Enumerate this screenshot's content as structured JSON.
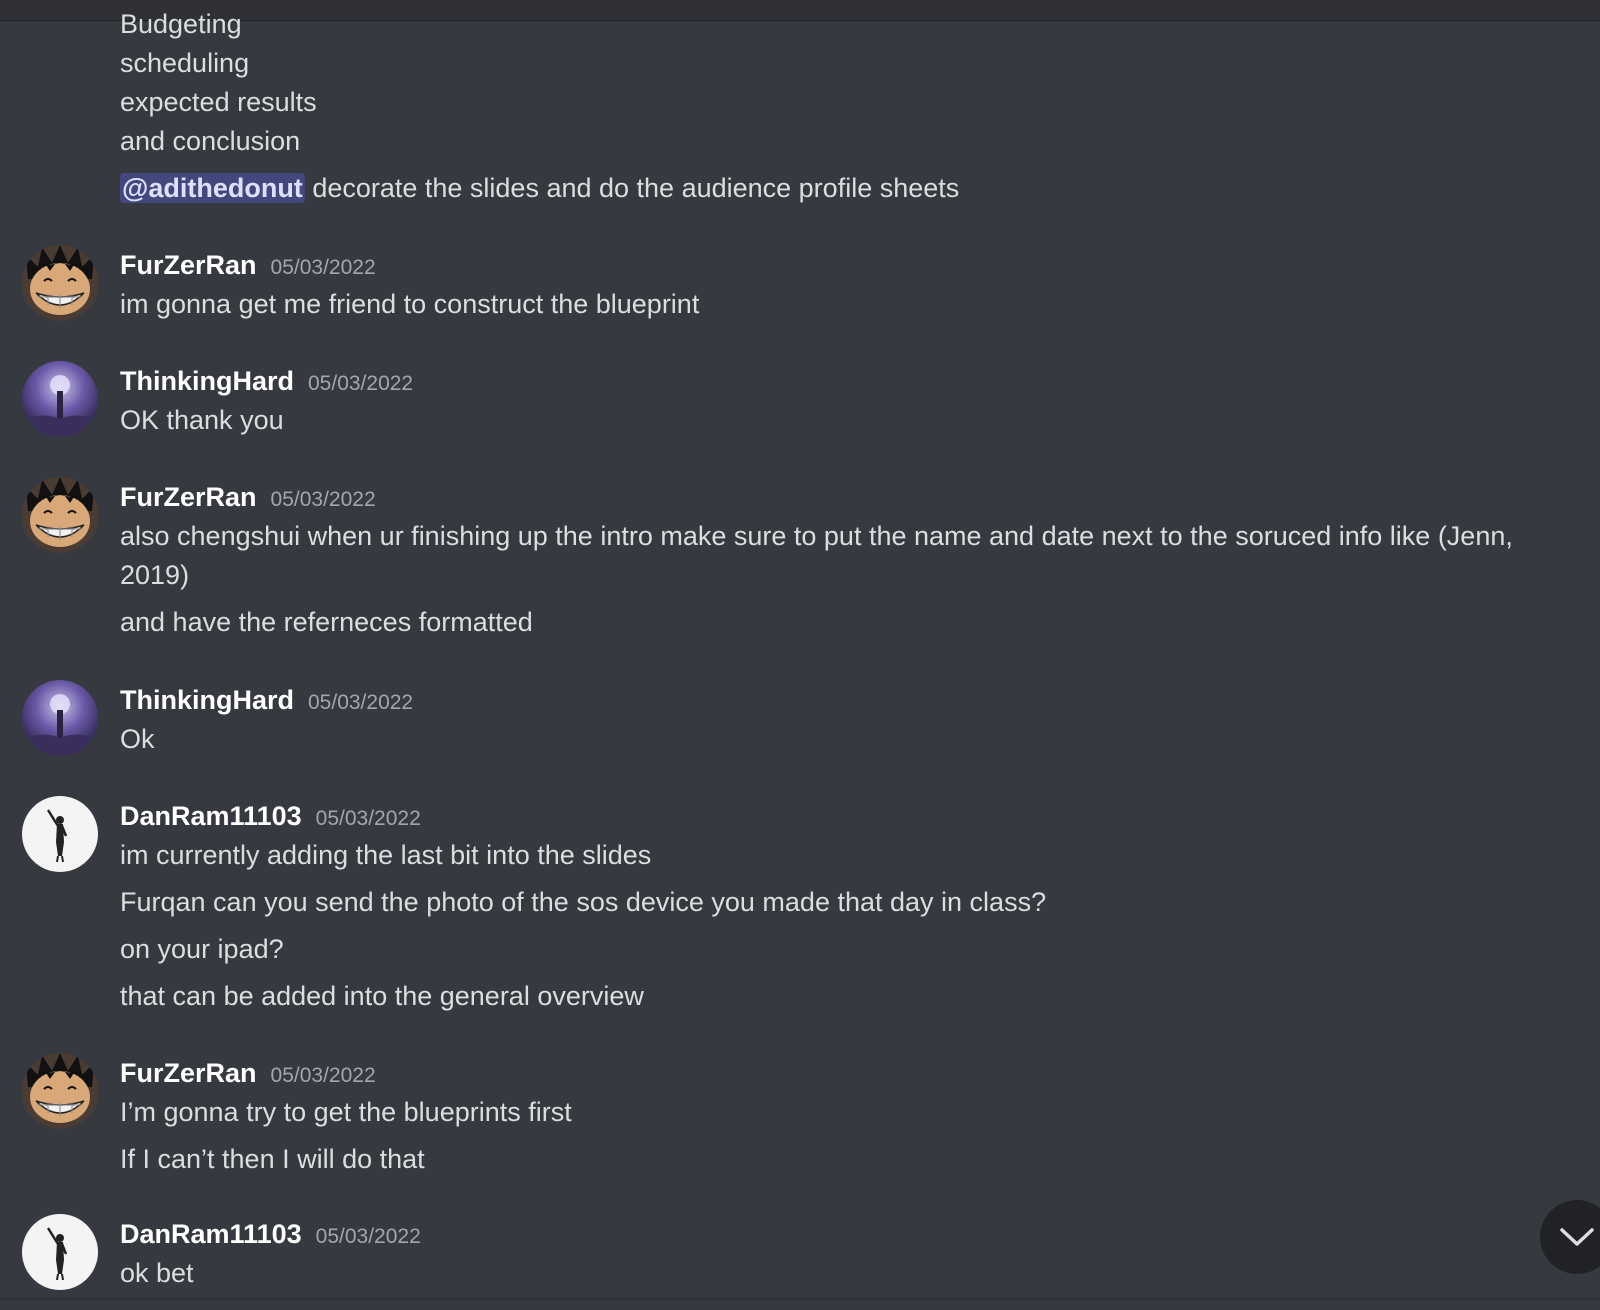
{
  "continuation": {
    "lines": [
      "Budgeting",
      "scheduling",
      "expected results",
      "and conclusion"
    ],
    "mention": "@adithedonut",
    "mention_text": " decorate the slides and do the audience profile sheets"
  },
  "messages": [
    {
      "user": "FurZerRan",
      "time": "05/03/2022",
      "avatar": "luffy-avatar",
      "lines": [
        "im gonna get me friend to construct the blueprint"
      ]
    },
    {
      "user": "ThinkingHard",
      "time": "05/03/2022",
      "avatar": "galaxy-avatar",
      "lines": [
        "OK thank you"
      ]
    },
    {
      "user": "FurZerRan",
      "time": "05/03/2022",
      "avatar": "luffy-avatar",
      "lines": [
        "also chengshui when ur finishing up the intro make sure to put the name and date next to the soruced info like (Jenn, 2019)",
        "and have the referneces formatted"
      ]
    },
    {
      "user": "ThinkingHard",
      "time": "05/03/2022",
      "avatar": "galaxy-avatar",
      "lines": [
        "Ok"
      ]
    },
    {
      "user": "DanRam11103",
      "time": "05/03/2022",
      "avatar": "silhouette-avatar",
      "lines": [
        "im currently adding the last bit into the slides",
        "Furqan can you send the photo of the sos device you made that day in class?",
        "on your ipad?",
        "that can be added into the general overview"
      ]
    },
    {
      "user": "FurZerRan",
      "time": "05/03/2022",
      "avatar": "luffy-avatar",
      "lines": [
        "I’m gonna try to get the blueprints first",
        "If I can’t then I will do that"
      ]
    },
    {
      "user": "DanRam11103",
      "time": "05/03/2022",
      "avatar": "silhouette-avatar",
      "lines": [
        "ok bet"
      ]
    }
  ],
  "scroll_button": {
    "icon": "chevron-down-icon"
  },
  "colors": {
    "background": "#36393f",
    "username": "#ffffff",
    "timestamp": "#a3a6aa",
    "text": "#dcddde",
    "mention_bg": "#5865f2"
  }
}
